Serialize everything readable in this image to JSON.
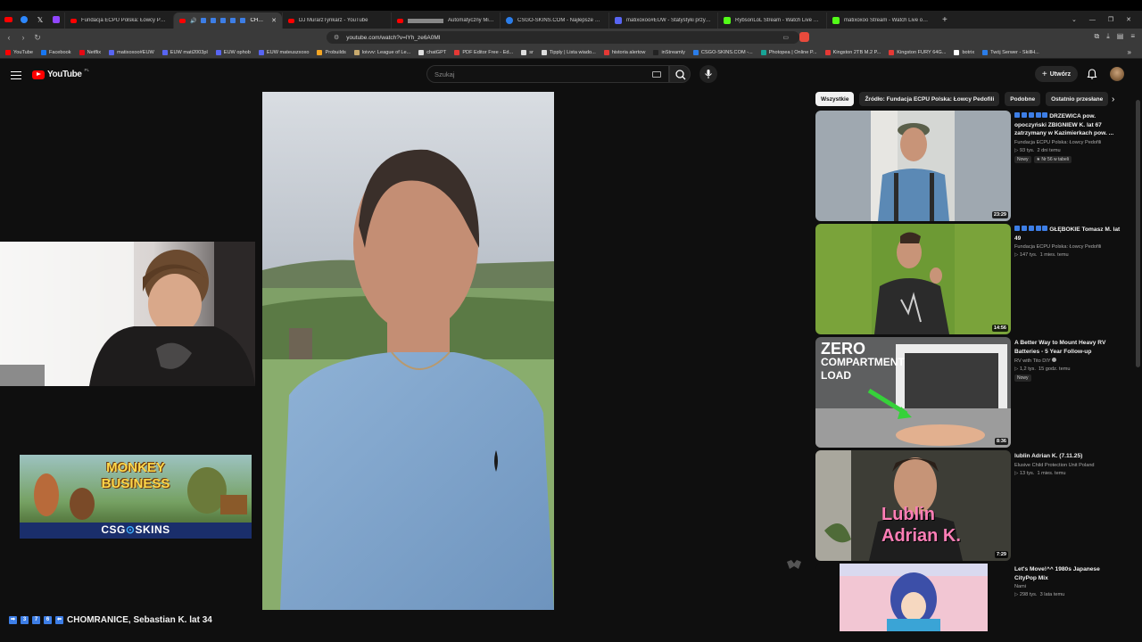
{
  "browser": {
    "tabs": [
      {
        "label": "Fundacja ECPU Polska: Łowcy Pedofil",
        "icon_color": "#ff0000"
      },
      {
        "label": "CHOMRANICE",
        "icon_color": "#ff0000",
        "active": true
      },
      {
        "label": "DJ MurarzTynkarz - YouTube",
        "icon_color": "#ff0000"
      },
      {
        "label": "Automatyczny Mixta",
        "icon_color": "#ff0000"
      },
      {
        "label": "CSGO-SKINS.COM - Najlepsze Skrzy",
        "icon_color": "#2b7de9"
      },
      {
        "label": "matixoxoo#EUW - Statystyki przywoł",
        "icon_color": "#5865f2"
      },
      {
        "label": "RybsonLoL Stream - Watch Live on K",
        "icon_color": "#53fc18"
      },
      {
        "label": "matixoxoo Stream - Watch Live on K",
        "icon_color": "#53fc18"
      }
    ],
    "url": "youtube.com/watch?v=lYh_ze6A0MI",
    "bookmarks": [
      {
        "label": "YouTube",
        "color": "#ff0000"
      },
      {
        "label": "Facebook",
        "color": "#1877f2"
      },
      {
        "label": "Netflix",
        "color": "#e50914"
      },
      {
        "label": "matixoxoo#EUW",
        "color": "#5865f2"
      },
      {
        "label": "EUW mati2003pl",
        "color": "#5865f2"
      },
      {
        "label": "EUW ophob",
        "color": "#5865f2"
      },
      {
        "label": "EUW mateuszxoxo",
        "color": "#5865f2"
      },
      {
        "label": "Probuilds",
        "color": "#f5a623"
      },
      {
        "label": "loivvv: League of Le...",
        "color": "#c8aa6e"
      },
      {
        "label": "chatGPT",
        "color": "#dddddd"
      },
      {
        "label": "PDF Editor Free - Ed...",
        "color": "#e53935"
      },
      {
        "label": "sr",
        "color": "#dddddd"
      },
      {
        "label": "Tipply | Lista wiado...",
        "color": "#dddddd"
      },
      {
        "label": "historia alertow",
        "color": "#e53935"
      },
      {
        "label": "inStreamly",
        "color": "#222222"
      },
      {
        "label": "CSGO-SKINS.COM -...",
        "color": "#2b7de9"
      },
      {
        "label": "Photopea | Online P...",
        "color": "#18a497"
      },
      {
        "label": "Kingston 2TB M.2 P...",
        "color": "#e53935"
      },
      {
        "label": "Kingston FURY 64G...",
        "color": "#e53935"
      },
      {
        "label": "botrix",
        "color": "#ffffff"
      },
      {
        "label": "Twój Serwer - SkillH...",
        "color": "#2b7de9"
      }
    ]
  },
  "youtube": {
    "logo_text": "YouTube",
    "country_code": "PL",
    "search_placeholder": "Szukaj",
    "create_label": "Utwórz",
    "video_title": "CHOMRANICE, Sebastian K. lat 34",
    "chips": [
      "Wszystkie",
      "Źródło: Fundacja ECPU Polska: Łowcy Pedofili",
      "Podobne",
      "Ostatnio przesłane"
    ],
    "recommendations": [
      {
        "title": "DRZEWICA pow. opoczyński ZBIGNIEW K. lat 67 zatrzymany w Kazimierkach pow. ...",
        "channel": "Fundacja ECPU Polska: Łowcy Pedofili",
        "views": "93 tys.",
        "age": "2 dni temu",
        "badges": [
          "Nowy",
          "Nr 56 w tabeli"
        ],
        "duration": "23:29"
      },
      {
        "title": "GŁĘBOKIE Tomasz M. lat 49",
        "channel": "Fundacja ECPU Polska: Łowcy Pedofili",
        "views": "147 tys.",
        "age": "1 mies. temu",
        "badges": [],
        "duration": "14:56"
      },
      {
        "title": "A Better Way to Mount Heavy RV Batteries - 5 Year Follow-up",
        "channel": "RV with Tito DIY",
        "views": "1,2 tys.",
        "age": "15 godz. temu",
        "badges": [
          "Nowy"
        ],
        "duration": "8:36",
        "thumb_text_1": "ZERO",
        "thumb_text_2": "COMPARTMENT",
        "thumb_text_3": "LOAD"
      },
      {
        "title": "lublin Adrian K. (7.11.25)",
        "channel": "Elusive Child Protection Unit Poland",
        "views": "13 tys.",
        "age": "1 mies. temu",
        "badges": [],
        "duration": "7:29",
        "thumb_text_1": "Lublin",
        "thumb_text_2": "Adrian K."
      },
      {
        "title": "Let's Move!^^ 1980s Japanese CityPop Mix",
        "channel": "Nami",
        "views": "298 tys.",
        "age": "3 lata temu",
        "badges": [],
        "duration": ""
      }
    ]
  },
  "ad": {
    "line1": "MONKEY",
    "line2": "BUSINESS",
    "brand_left": "CSG",
    "brand_right": "SKINS"
  }
}
